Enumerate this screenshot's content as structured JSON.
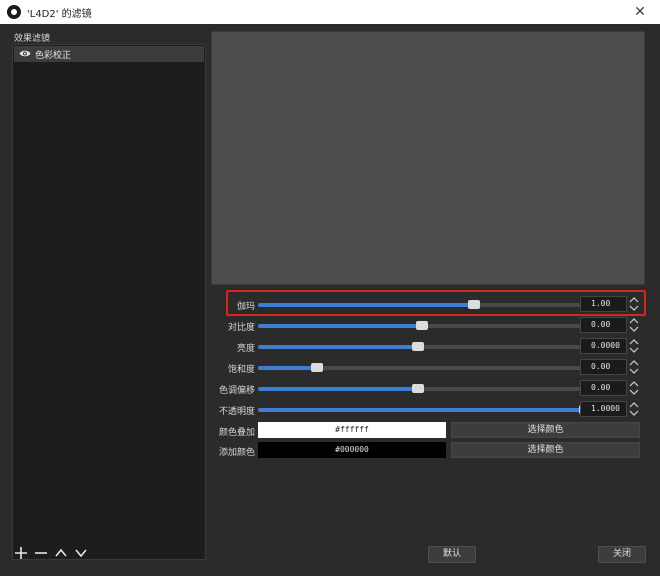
{
  "window": {
    "title": "'L4D2' 的滤镜",
    "close_glyph": "✕"
  },
  "filters": {
    "label": "效果滤镜",
    "items": [
      {
        "name": "色彩校正",
        "icon": "eye-icon"
      }
    ]
  },
  "properties": {
    "gamma": {
      "label": "伽玛",
      "value": "1.00",
      "fraction": 0.66
    },
    "contrast": {
      "label": "对比度",
      "value": "0.00",
      "fraction": 0.5
    },
    "brightness": {
      "label": "亮度",
      "value": "0.0000",
      "fraction": 0.49
    },
    "saturation": {
      "label": "饱和度",
      "value": "0.00",
      "fraction": 0.18
    },
    "hue_shift": {
      "label": "色调偏移",
      "value": "0.00",
      "fraction": 0.49
    },
    "opacity": {
      "label": "不透明度",
      "value": "1.0000",
      "fraction": 1.0
    },
    "color_multiply": {
      "label": "颜色叠加",
      "value": "#ffffff",
      "swatch_color": "#ffffff",
      "text_color": "#222222",
      "button": "选择颜色"
    },
    "color_add": {
      "label": "添加颜色",
      "value": "#000000",
      "swatch_color": "#000000",
      "text_color": "#e0e0e0",
      "button": "选择颜色"
    }
  },
  "buttons": {
    "defaults": "默认",
    "close": "关闭"
  },
  "colors": {
    "accent": "#3d7fd0",
    "highlight": "#d9251d"
  }
}
